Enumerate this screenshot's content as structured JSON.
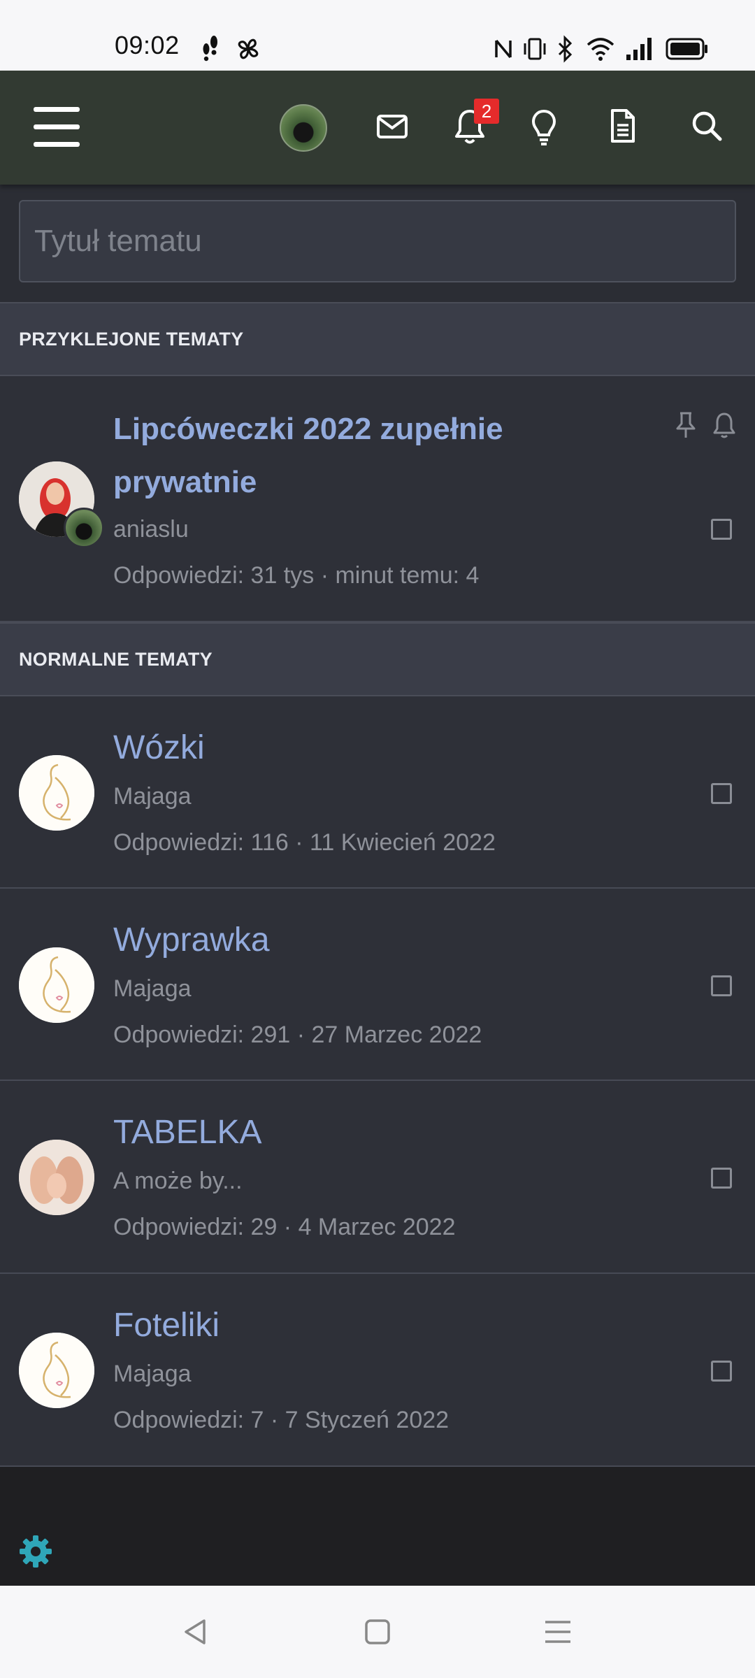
{
  "status_bar": {
    "time": "09:02",
    "left_icons": [
      "footsteps-icon",
      "fan-icon"
    ],
    "right_icons": [
      "nfc-icon",
      "vibrate-icon",
      "bluetooth-icon",
      "wifi-icon",
      "signal-icon",
      "battery-icon"
    ]
  },
  "header": {
    "menu_icon": "hamburger-menu-icon",
    "avatar": "user-avatar",
    "icons": [
      "mail-icon",
      "bell-icon",
      "lightbulb-icon",
      "document-icon",
      "search-icon"
    ],
    "notifications_count": "2",
    "accent_color": "#323a32"
  },
  "new_topic": {
    "placeholder": "Tytuł tematu"
  },
  "sections": {
    "sticky": "PRZYKLEJONE TEMATY",
    "normal": "NORMALNE TEMATY"
  },
  "sticky_threads": [
    {
      "title": "Lipcóweczki 2022 zupełnie prywatnie",
      "author": "aniaslu",
      "meta": "Odpowiedzi: 31 tys · minut temu: 4",
      "icons": [
        "pin-icon",
        "bell-icon"
      ]
    }
  ],
  "normal_threads": [
    {
      "title": "Wózki",
      "author": "Majaga",
      "meta": "Odpowiedzi: 116 · 11 Kwiecień 2022"
    },
    {
      "title": "Wyprawka",
      "author": "Majaga",
      "meta": "Odpowiedzi: 291 · 27 Marzec 2022"
    },
    {
      "title": "TABELKA",
      "author": "A może by...",
      "meta": "Odpowiedzi: 29 · 4 Marzec 2022"
    },
    {
      "title": "Foteliki",
      "author": "Majaga",
      "meta": "Odpowiedzi: 7 · 7 Styczeń 2022"
    }
  ],
  "footer": {
    "settings_icon": "gear-icon",
    "accent_color": "#2fa6b8"
  },
  "nav_bar": {
    "buttons": [
      "back-icon",
      "home-icon",
      "recents-icon"
    ]
  }
}
